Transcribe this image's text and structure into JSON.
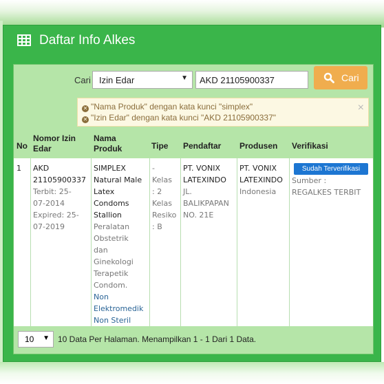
{
  "panel": {
    "title": "Daftar Info Alkes"
  },
  "search": {
    "label": "Cari",
    "field_selected": "Izin Edar",
    "keyword_value": "AKD 21105900337",
    "button_label": "Cari"
  },
  "filters": [
    "\"Nama Produk\" dengan kata kunci \"simplex\"",
    "\"Izin Edar\" dengan kata kunci \"AKD 21105900337\""
  ],
  "table": {
    "headers": {
      "no": "No",
      "izin_1": "Nomor Izin",
      "izin_2": "Edar",
      "nama_1": "Nama",
      "nama_2": "Produk",
      "tipe": "Tipe",
      "pendaftar": "Pendaftar",
      "produsen": "Produsen",
      "verifikasi": "Verifikasi"
    },
    "row": {
      "no": "1",
      "izin": {
        "l1": "AKD",
        "l2": "21105900337",
        "l3": "Terbit: 25-",
        "l4": "07-2014",
        "l5": "Expired: 25-",
        "l6": "07-2019"
      },
      "nama": {
        "l1": "SIMPLEX",
        "l2": "Natural Male",
        "l3": "Latex",
        "l4": "Condoms",
        "l5": "Stallion",
        "l6": "Peralatan",
        "l7": "Obstetrik",
        "l8": "dan",
        "l9": "Ginekologi",
        "l10": "Terapetik",
        "l11": "Condom.",
        "l12": "Non",
        "l13": "Elektromedik",
        "l14": "Non Steril"
      },
      "tipe": {
        "l1": "-",
        "l2": "Kelas",
        "l3": ": 2",
        "l4": "Kelas",
        "l5": "Resiko",
        "l6": ": B"
      },
      "pendaftar": {
        "l1": "PT. VONIX",
        "l2": "LATEXINDO",
        "l3": "JL.",
        "l4": "BALIKPAPAN",
        "l5": "NO. 21E"
      },
      "produsen": {
        "l1": "PT. VONIX",
        "l2": "LATEXINDO",
        "l3": "Indonesia"
      },
      "verifikasi": {
        "badge": "Sudah Terverifikasi",
        "l1": "Sumber :",
        "l2": "REGALKES TERBIT"
      }
    }
  },
  "footer": {
    "per_page": "10",
    "summary": "10 Data Per Halaman. Menampilkan 1 - 1 Dari 1 Data."
  },
  "colors": {
    "panel_green": "#3ab54a",
    "button_orange": "#f0ad4e",
    "badge_blue": "#1d76d2"
  },
  "icons": [
    "table-grid-icon",
    "search-icon",
    "remove-circle-icon",
    "close-icon",
    "caret-down-icon"
  ]
}
